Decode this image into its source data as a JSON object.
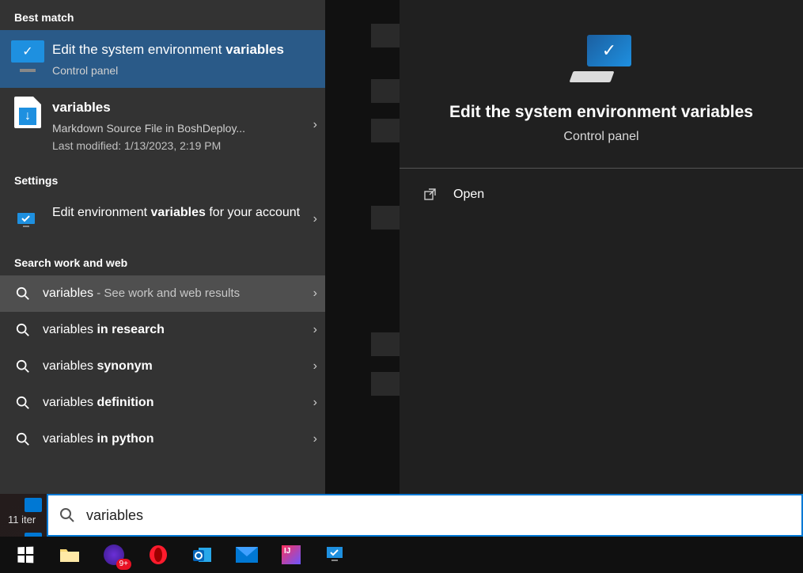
{
  "desktop": {
    "status_text": "11 iter"
  },
  "search": {
    "sections": {
      "best_match": "Best match",
      "settings": "Settings",
      "work_web": "Search work and web"
    },
    "best_match": {
      "title_pre": "Edit the system environment ",
      "title_bold": "variables",
      "subtitle": "Control panel"
    },
    "file_result": {
      "title": "variables",
      "sub1": "Markdown Source File in BoshDeploy...",
      "sub2": "Last modified: 1/13/2023, 2:19 PM"
    },
    "settings_result": {
      "pre": "Edit environment ",
      "bold": "variables",
      "post": " for your account"
    },
    "web": [
      {
        "term": "variables",
        "suffix": "",
        "tail": " - See work and web results",
        "hl": true
      },
      {
        "term": "variables",
        "suffix": " in research",
        "tail": "",
        "hl": false
      },
      {
        "term": "variables",
        "suffix": " synonym",
        "tail": "",
        "hl": false
      },
      {
        "term": "variables",
        "suffix": " definition",
        "tail": "",
        "hl": false
      },
      {
        "term": "variables",
        "suffix": " in python",
        "tail": "",
        "hl": false
      }
    ],
    "input_value": "variables"
  },
  "preview": {
    "title": "Edit the system environment variables",
    "subtitle": "Control panel",
    "open_label": "Open"
  },
  "taskbar": {
    "badge": "9+"
  }
}
